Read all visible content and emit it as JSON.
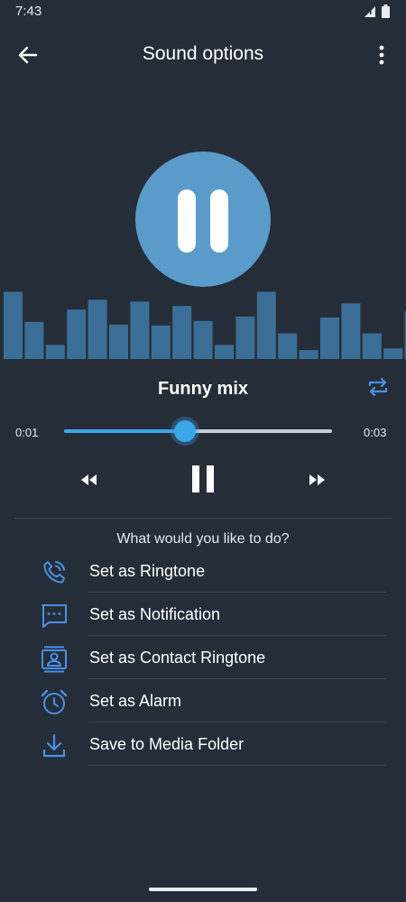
{
  "status": {
    "time": "7:43"
  },
  "app_bar": {
    "title": "Sound options"
  },
  "player": {
    "track_title": "Funny mix",
    "elapsed": "0:01",
    "duration": "0:03",
    "progress": 0.45
  },
  "visualizer": {
    "levels": [
      0.76,
      0.42,
      0.16,
      0.56,
      0.67,
      0.39,
      0.65,
      0.38,
      0.6,
      0.43,
      0.16,
      0.48,
      0.76,
      0.29,
      0.1,
      0.47,
      0.63,
      0.29,
      0.12,
      0.54
    ]
  },
  "actions": {
    "prompt": "What would you like to do?",
    "items": [
      {
        "label": "Set as Ringtone",
        "icon": "phone-ringing-icon"
      },
      {
        "label": "Set as Notification",
        "icon": "chat-bubble-icon"
      },
      {
        "label": "Set as Contact Ringtone",
        "icon": "contact-card-icon"
      },
      {
        "label": "Set as Alarm",
        "icon": "alarm-clock-icon"
      },
      {
        "label": "Save to Media Folder",
        "icon": "download-icon"
      }
    ]
  },
  "colors": {
    "background": "#252e38",
    "accent": "#3aa7e8",
    "icon_blue": "#4b8fe8",
    "circle": "#5a9bc9",
    "bar": "#3b6e96"
  }
}
